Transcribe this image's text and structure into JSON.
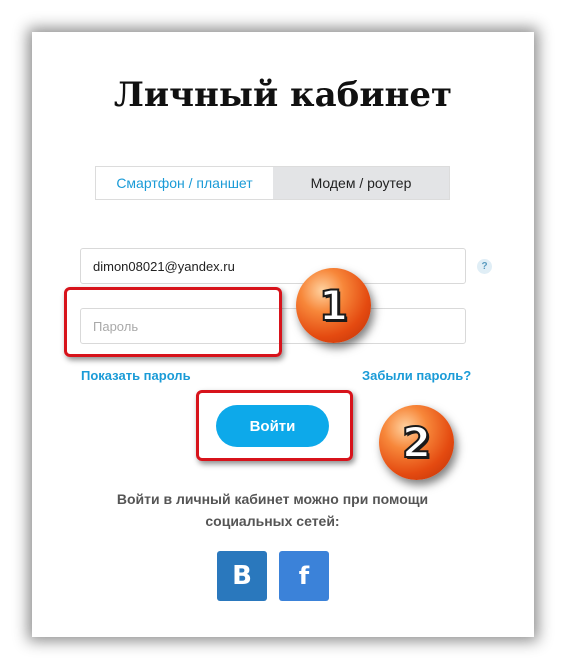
{
  "page": {
    "title": "Личный кабинет"
  },
  "tabs": [
    {
      "label": "Смартфон / планшет",
      "active": true
    },
    {
      "label": "Модем / роутер",
      "active": false
    }
  ],
  "form": {
    "email_value": "dimon08021@yandex.ru",
    "password_placeholder": "Пароль",
    "help_icon": "?",
    "show_password_label": "Показать пароль",
    "forgot_password_label": "Забыли пароль?",
    "login_label": "Войти"
  },
  "social": {
    "text": "Войти в личный кабинет можно при помощи социальных сетей:",
    "vk_label": "B",
    "fb_label": "f",
    "vk_icon": "vk-icon",
    "fb_icon": "facebook-icon"
  },
  "annotations": {
    "badge_1": "1",
    "badge_2": "2",
    "highlight_color": "#d7131b",
    "badge_color": "#f26a22"
  },
  "colors": {
    "accent": "#1a9bd7",
    "login_button": "#0da9ea",
    "vk": "#2a78bd",
    "facebook": "#3b82d9"
  }
}
